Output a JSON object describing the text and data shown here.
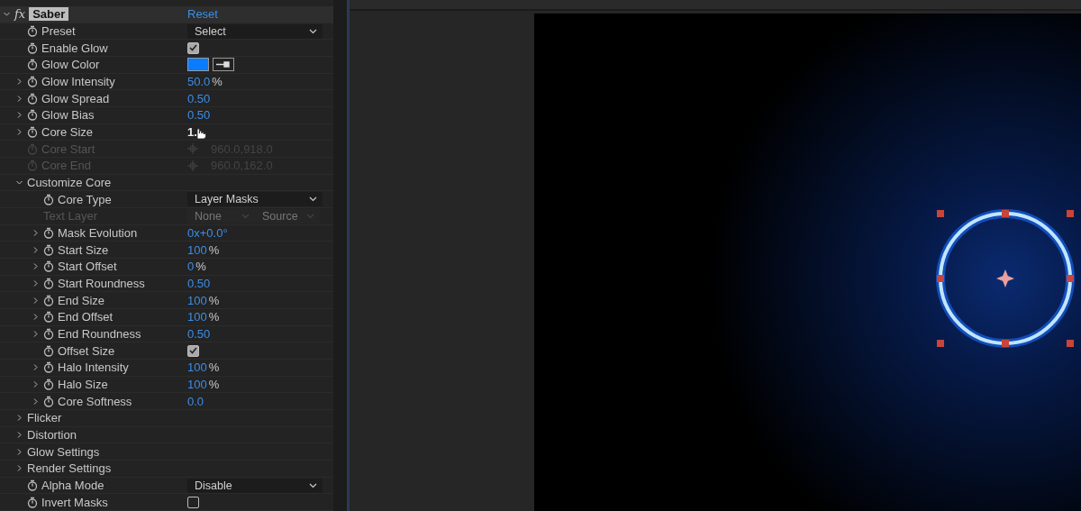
{
  "effect": {
    "badge": "fx",
    "label": "Saber",
    "expanded": true,
    "reset": "Reset",
    "params": [
      {
        "kind": "dropdown",
        "label": "Preset",
        "value": "Select",
        "disabled": false
      },
      {
        "kind": "checkbox",
        "label": "Enable Glow",
        "checked": true,
        "disabled": false
      },
      {
        "kind": "color",
        "label": "Glow Color",
        "color": "#0a7cff",
        "disabled": false
      },
      {
        "kind": "number",
        "label": "Glow Intensity",
        "value": "50.0",
        "unit": "%",
        "expanded": false,
        "disabled": false
      },
      {
        "kind": "number",
        "label": "Glow Spread",
        "value": "0.50",
        "expanded": false,
        "disabled": false
      },
      {
        "kind": "number",
        "label": "Glow Bias",
        "value": "0.50",
        "expanded": false,
        "disabled": false
      },
      {
        "kind": "number",
        "label": "Core Size",
        "value": "1.",
        "expanded": false,
        "disabled": false,
        "hover": true
      },
      {
        "kind": "point",
        "label": "Core Start",
        "value": "960.0,918.0",
        "disabled": true
      },
      {
        "kind": "point",
        "label": "Core End",
        "value": "960.0,162.0",
        "disabled": true
      },
      {
        "kind": "group",
        "label": "Customize Core",
        "expanded": true,
        "children": [
          {
            "kind": "dropdown",
            "label": "Core Type",
            "value": "Layer Masks",
            "disabled": false
          },
          {
            "kind": "dual",
            "label": "Text Layer",
            "value": "None",
            "value_2": "Source",
            "disabled": true
          },
          {
            "kind": "number",
            "label": "Mask Evolution",
            "value": "0x+0.0°",
            "expanded": false,
            "disabled": false
          },
          {
            "kind": "number",
            "label": "Start Size",
            "value": "100",
            "unit": "%",
            "expanded": false,
            "disabled": false
          },
          {
            "kind": "number",
            "label": "Start Offset",
            "value": "0",
            "unit": "%",
            "expanded": false,
            "disabled": false
          },
          {
            "kind": "number",
            "label": "Start Roundness",
            "value": "0.50",
            "expanded": false,
            "disabled": false
          },
          {
            "kind": "number",
            "label": "End Size",
            "value": "100",
            "unit": "%",
            "expanded": false,
            "disabled": false
          },
          {
            "kind": "number",
            "label": "End Offset",
            "value": "100",
            "unit": "%",
            "expanded": false,
            "disabled": false
          },
          {
            "kind": "number",
            "label": "End Roundness",
            "value": "0.50",
            "expanded": false,
            "disabled": false
          },
          {
            "kind": "checkbox",
            "label": "Offset Size",
            "checked": true,
            "disabled": false
          },
          {
            "kind": "number",
            "label": "Halo Intensity",
            "value": "100",
            "unit": "%",
            "expanded": false,
            "disabled": false
          },
          {
            "kind": "number",
            "label": "Halo Size",
            "value": "100",
            "unit": "%",
            "expanded": false,
            "disabled": false
          },
          {
            "kind": "number",
            "label": "Core Softness",
            "value": "0.0",
            "expanded": false,
            "disabled": false
          }
        ]
      },
      {
        "kind": "group",
        "label": "Flicker",
        "expanded": false
      },
      {
        "kind": "group",
        "label": "Distortion",
        "expanded": false
      },
      {
        "kind": "group",
        "label": "Glow Settings",
        "expanded": false
      },
      {
        "kind": "group",
        "label": "Render Settings",
        "expanded": false
      },
      {
        "kind": "dropdown",
        "label": "Alpha Mode",
        "value": "Disable",
        "disabled": false
      },
      {
        "kind": "checkbox",
        "label": "Invert Masks",
        "checked": false,
        "disabled": false
      }
    ]
  }
}
